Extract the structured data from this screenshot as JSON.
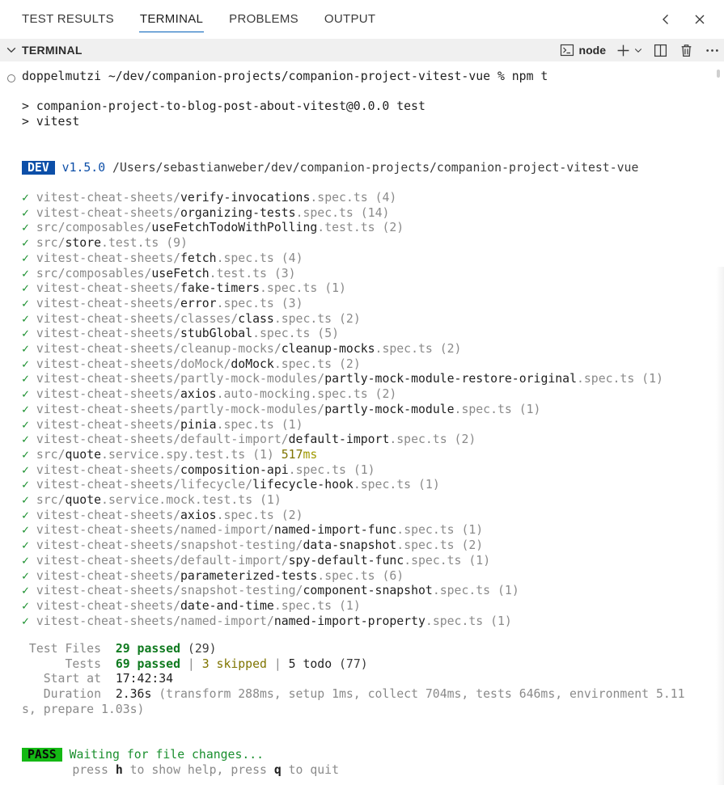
{
  "tabs": [
    {
      "label": "TEST RESULTS"
    },
    {
      "label": "TERMINAL"
    },
    {
      "label": "PROBLEMS"
    },
    {
      "label": "OUTPUT"
    }
  ],
  "panel": {
    "title": "TERMINAL",
    "terminal_name": "node"
  },
  "terminal": {
    "prompt": "doppelmutzi ~/dev/companion-projects/companion-project-vitest-vue % npm t",
    "script_line1": "> companion-project-to-blog-post-about-vitest@0.0.0 test",
    "script_line2": "> vitest",
    "dev_badge": "DEV",
    "version": "v1.5.0",
    "cwd": "/Users/sebastianweber/dev/companion-projects/companion-project-vitest-vue",
    "check": "✓",
    "tests": [
      {
        "dir": "vitest-cheat-sheets/",
        "name": "verify-invocations",
        "ext": ".spec.ts",
        "count": " (4)"
      },
      {
        "dir": "vitest-cheat-sheets/",
        "name": "organizing-tests",
        "ext": ".spec.ts",
        "count": " (14)"
      },
      {
        "dir": "src/composables/",
        "name": "useFetchTodoWithPolling",
        "ext": ".test.ts",
        "count": " (2)"
      },
      {
        "dir": "src/",
        "name": "store",
        "ext": ".test.ts",
        "count": " (9)"
      },
      {
        "dir": "vitest-cheat-sheets/",
        "name": "fetch",
        "ext": ".spec.ts",
        "count": " (4)"
      },
      {
        "dir": "src/composables/",
        "name": "useFetch",
        "ext": ".test.ts",
        "count": " (3)"
      },
      {
        "dir": "vitest-cheat-sheets/",
        "name": "fake-timers",
        "ext": ".spec.ts",
        "count": " (1)"
      },
      {
        "dir": "vitest-cheat-sheets/",
        "name": "error",
        "ext": ".spec.ts",
        "count": " (3)"
      },
      {
        "dir": "vitest-cheat-sheets/classes/",
        "name": "class",
        "ext": ".spec.ts",
        "count": " (2)"
      },
      {
        "dir": "vitest-cheat-sheets/",
        "name": "stubGlobal",
        "ext": ".spec.ts",
        "count": " (5)"
      },
      {
        "dir": "vitest-cheat-sheets/cleanup-mocks/",
        "name": "cleanup-mocks",
        "ext": ".spec.ts",
        "count": " (2)"
      },
      {
        "dir": "vitest-cheat-sheets/doMock/",
        "name": "doMock",
        "ext": ".spec.ts",
        "count": " (2)"
      },
      {
        "dir": "vitest-cheat-sheets/partly-mock-modules/",
        "name": "partly-mock-module-restore-original",
        "ext": ".spec.ts",
        "count": " (1)"
      },
      {
        "dir": "vitest-cheat-sheets/",
        "name": "axios",
        "ext": ".auto-mocking.spec.ts",
        "count": " (2)"
      },
      {
        "dir": "vitest-cheat-sheets/partly-mock-modules/",
        "name": "partly-mock-module",
        "ext": ".spec.ts",
        "count": " (1)"
      },
      {
        "dir": "vitest-cheat-sheets/",
        "name": "pinia",
        "ext": ".spec.ts",
        "count": " (1)"
      },
      {
        "dir": "vitest-cheat-sheets/default-import/",
        "name": "default-import",
        "ext": ".spec.ts",
        "count": " (2)"
      },
      {
        "dir": "src/",
        "name": "quote",
        "ext": ".service.spy.test.ts",
        "count": " (1) ",
        "duration": "517",
        "unit": "ms"
      },
      {
        "dir": "vitest-cheat-sheets/",
        "name": "composition-api",
        "ext": ".spec.ts",
        "count": " (1)"
      },
      {
        "dir": "vitest-cheat-sheets/lifecycle/",
        "name": "lifecycle-hook",
        "ext": ".spec.ts",
        "count": " (1)"
      },
      {
        "dir": "src/",
        "name": "quote",
        "ext": ".service.mock.test.ts",
        "count": " (1)"
      },
      {
        "dir": "vitest-cheat-sheets/",
        "name": "axios",
        "ext": ".spec.ts",
        "count": " (2)"
      },
      {
        "dir": "vitest-cheat-sheets/named-import/",
        "name": "named-import-func",
        "ext": ".spec.ts",
        "count": " (1)"
      },
      {
        "dir": "vitest-cheat-sheets/snapshot-testing/",
        "name": "data-snapshot",
        "ext": ".spec.ts",
        "count": " (2)"
      },
      {
        "dir": "vitest-cheat-sheets/default-import/",
        "name": "spy-default-func",
        "ext": ".spec.ts",
        "count": " (1)"
      },
      {
        "dir": "vitest-cheat-sheets/",
        "name": "parameterized-tests",
        "ext": ".spec.ts",
        "count": " (6)"
      },
      {
        "dir": "vitest-cheat-sheets/snapshot-testing/",
        "name": "component-snapshot",
        "ext": ".spec.ts",
        "count": " (1)"
      },
      {
        "dir": "vitest-cheat-sheets/",
        "name": "date-and-time",
        "ext": ".spec.ts",
        "count": " (1)"
      },
      {
        "dir": "vitest-cheat-sheets/named-import/",
        "name": "named-import-property",
        "ext": ".spec.ts",
        "count": " (1)"
      }
    ],
    "summary": {
      "files_label": " Test Files  ",
      "files_passed": "29 passed",
      "files_total": " (29)",
      "tests_label": "      Tests  ",
      "tests_passed": "69 passed",
      "sep1": " | ",
      "tests_skipped": "3 skipped",
      "sep2": " | ",
      "tests_todo": "5 todo",
      "tests_total": " (77)",
      "start_label": "   Start at  ",
      "start_value": "17:42:34",
      "duration_label": "   Duration  ",
      "duration_value": "2.36s",
      "duration_detail": " (transform 288ms, setup 1ms, collect 704ms, tests 646ms, environment 5.11",
      "duration_detail2": "s, prepare 1.03s)"
    },
    "pass_badge": "PASS",
    "waiting": "Waiting for file changes...",
    "help_pre": "       press ",
    "help_key_h": "h",
    "help_mid": " to show help, press ",
    "help_key_q": "q",
    "help_post": " to quit"
  },
  "colors": {
    "accent": "#005fb8",
    "dev_badge_bg": "#0d4fa8",
    "pass_badge_bg": "#14b814",
    "success": "#1a8f2e"
  }
}
